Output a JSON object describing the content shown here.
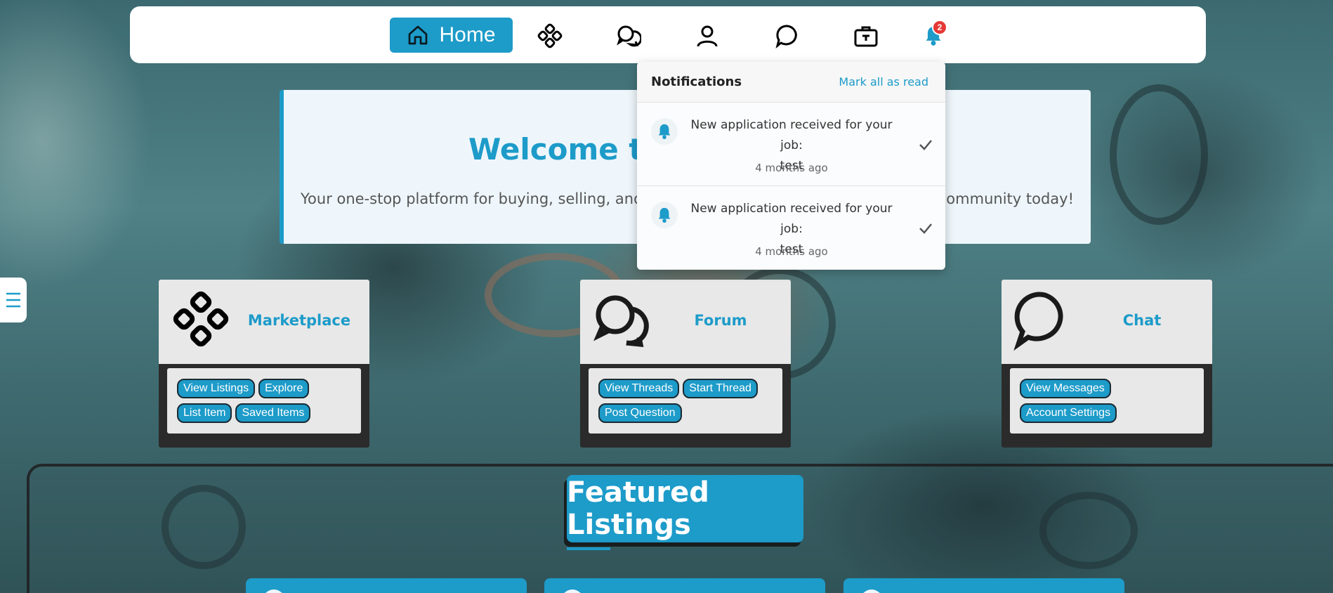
{
  "nav": {
    "home_label": "Home",
    "notification_count": "2"
  },
  "hero": {
    "title": "Welcome to A",
    "subtitle_left": "Your one-stop platform for buying, selling, and di",
    "subtitle_right": "community today!"
  },
  "cards": [
    {
      "title": "Marketplace",
      "links": [
        "View Listings",
        "Explore",
        "List Item",
        "Saved Items"
      ]
    },
    {
      "title": "Forum",
      "links": [
        "View Threads",
        "Start Thread",
        "Post Question"
      ]
    },
    {
      "title": "Chat",
      "links": [
        "View Messages",
        "Account Settings"
      ]
    }
  ],
  "featured": {
    "title": "Featured Listings"
  },
  "notifications": {
    "title": "Notifications",
    "mark_all": "Mark all as read",
    "items": [
      {
        "line1": "New application received for your job:",
        "line2": "test",
        "time": "4 months ago"
      },
      {
        "line1": "New application received for your job:",
        "line2": "test",
        "time": "4 months ago"
      }
    ]
  },
  "colors": {
    "accent": "#1d9bc9",
    "badge": "#e53935",
    "card_head": "#e8e8e8",
    "card_frame": "#2b2b2b"
  }
}
